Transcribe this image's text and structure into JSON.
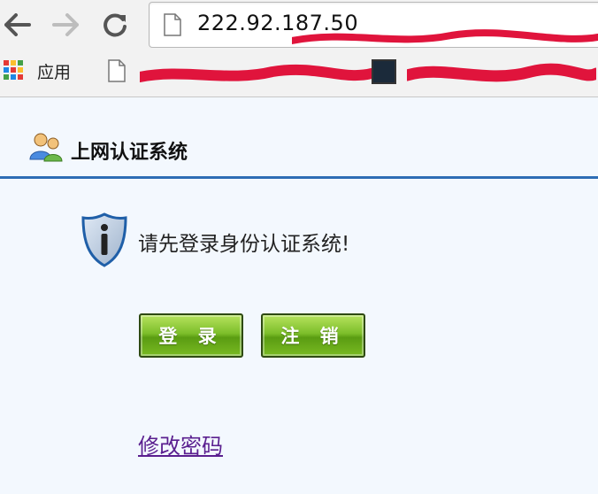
{
  "browser": {
    "url": "222.92.187.50",
    "bookmarks": {
      "apps_label": "应用"
    }
  },
  "page": {
    "system_title": "上网认证系统",
    "notice": "请先登录身份认证系统!",
    "login_button": "登 录",
    "logout_button": "注 销",
    "change_password_link": "修改密码"
  },
  "colors": {
    "header_rule": "#2e6db5",
    "button_green": "#7cbe2a",
    "link_visited": "#5a1f8f",
    "redaction_red": "#e0143c"
  },
  "icons": {
    "back": "back-arrow-icon",
    "forward": "forward-arrow-icon",
    "reload": "reload-icon",
    "page": "page-icon",
    "apps": "apps-grid-icon",
    "users": "users-icon",
    "info": "info-shield-icon"
  }
}
